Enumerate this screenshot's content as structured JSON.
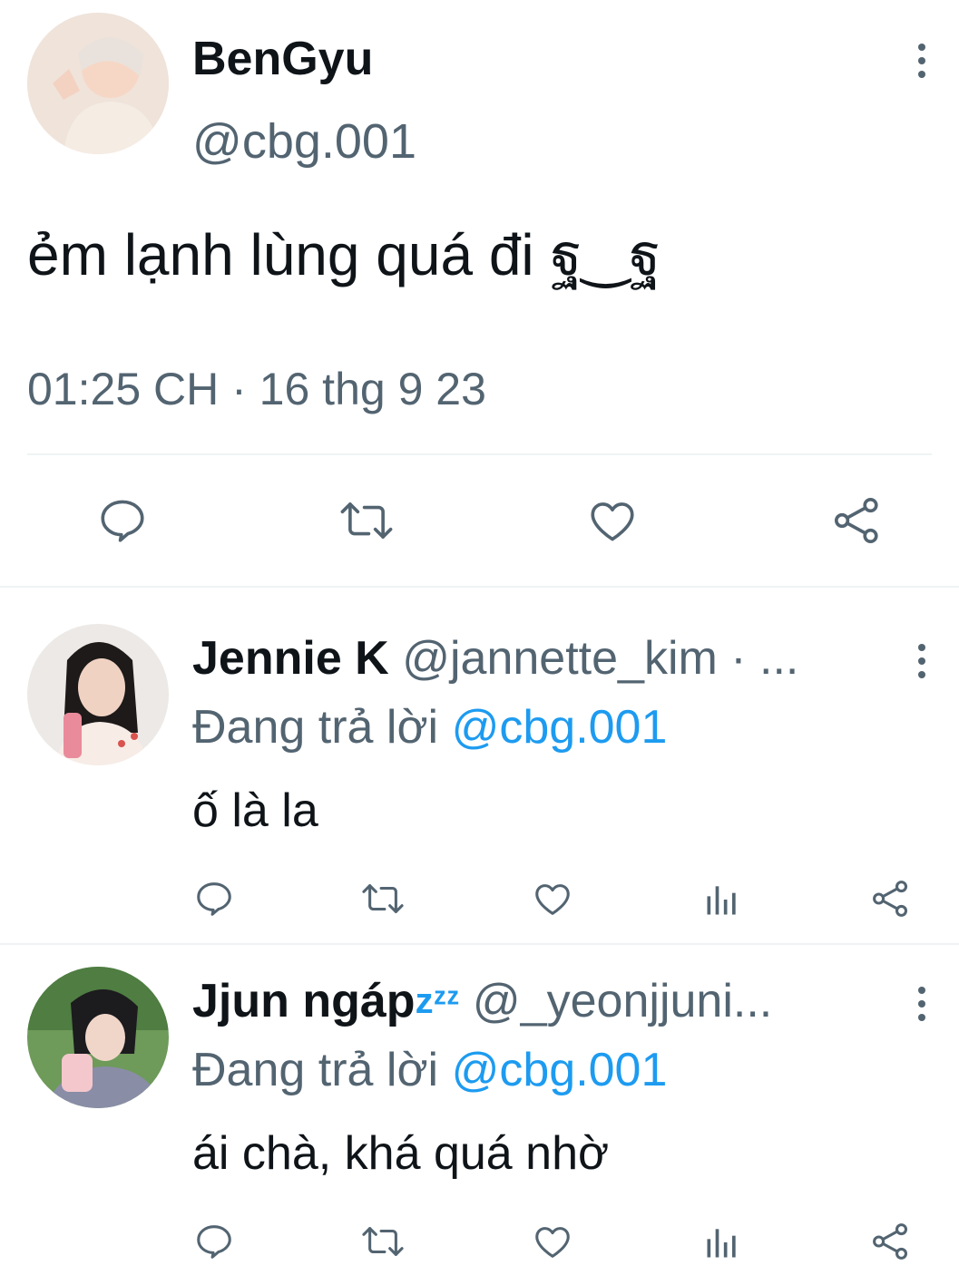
{
  "main_tweet": {
    "display_name": "BenGyu",
    "handle": "@cbg.001",
    "text": "ẻm lạnh lùng quá đi ฐ‿ฐ",
    "timestamp": "01:25 CH · 16 thg 9 23",
    "avatar_icon": "person-avatar"
  },
  "action_icons": [
    "reply-icon",
    "retweet-icon",
    "like-icon",
    "views-icon",
    "share-icon"
  ],
  "replies": [
    {
      "display_name": "Jennie K",
      "handle": "@jannette_kim · ...",
      "replying_prefix": "Đang trả lời",
      "replying_to": "@cbg.001",
      "text": "ố là la"
    },
    {
      "display_name": "Jjun ngáp",
      "name_emoji": "zᶻᶻ",
      "handle": "@_yeonjjuni...",
      "replying_prefix": "Đang trả lời",
      "replying_to": "@cbg.001",
      "text": "ái chà, khá quá nhờ"
    }
  ],
  "colors": {
    "text": "#0f1419",
    "muted": "#536471",
    "link": "#1d9bf0",
    "divider": "#eff3f4",
    "zzz": "#1d9bf0"
  }
}
